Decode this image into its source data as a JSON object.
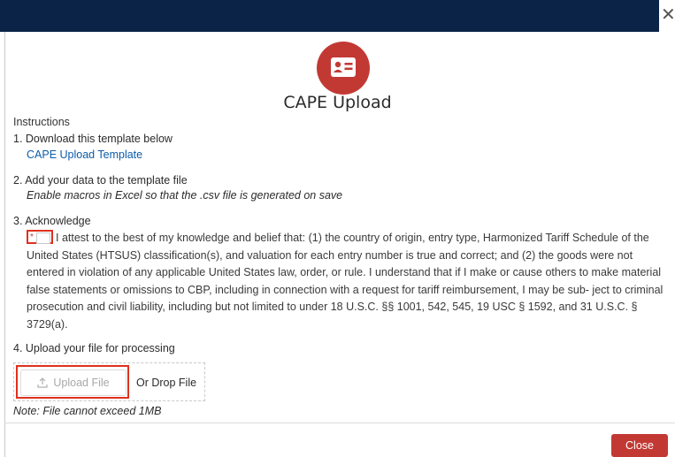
{
  "modal": {
    "title": "CAPE Upload",
    "close_icon": "✕",
    "icon": "contact-card-icon",
    "accent_color": "#c23934",
    "header_color": "#0a2347"
  },
  "instructions": {
    "label": "Instructions",
    "step1": {
      "label": "1. Download this template below",
      "link": "CAPE Upload Template"
    },
    "step2": {
      "label": "2. Add your data to the template file",
      "note": "Enable macros in Excel so that the .csv file is generated on save"
    },
    "step3": {
      "label": "3. Acknowledge",
      "required_marker": "*",
      "checked": false,
      "text": "I attest to the best of my knowledge and belief that: (1) the country of origin, entry type, Harmonized Tariff Schedule of the United States (HTSUS) classification(s), and valuation for each entry number is true and correct; and (2) the goods were not entered in violation of any applicable United States law, order, or rule. I understand that if I make or cause others to make material false statements or omissions to CBP, including in connection with a request for tariff reimbursement, I may be sub- ject to criminal prosecution and civil liability, including but not limited to under 18 U.S.C. §§ 1001, 542, 545, 19 USC § 1592, and 31 U.S.C. § 3729(a)."
    },
    "step4": {
      "label": "4. Upload your file for processing",
      "upload_button": "Upload File",
      "drop_text": "Or Drop File",
      "note": "Note: File cannot exceed 1MB"
    }
  },
  "footer": {
    "close_button": "Close"
  }
}
